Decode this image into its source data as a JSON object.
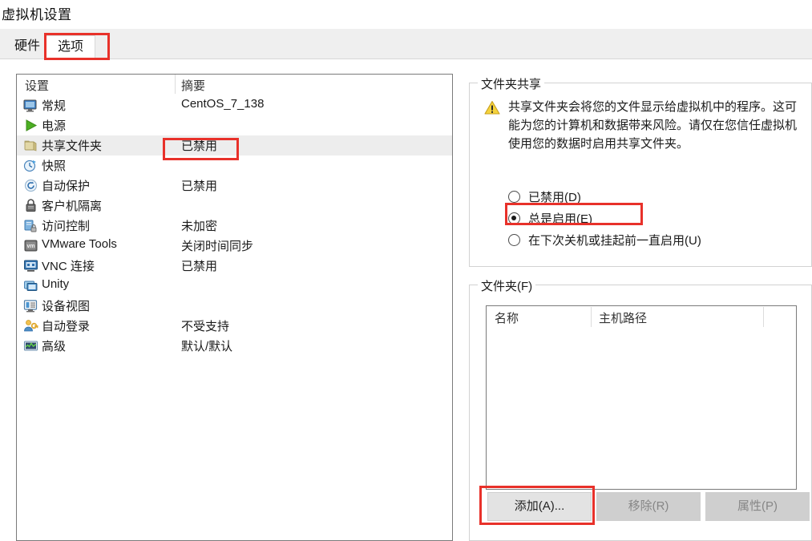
{
  "dialog": {
    "title": "虚拟机设置"
  },
  "tabs": [
    {
      "label": "硬件",
      "active": false
    },
    {
      "label": "选项",
      "active": true
    }
  ],
  "settings_list": {
    "columns": [
      "设置",
      "摘要"
    ],
    "rows": [
      {
        "label": "常规",
        "summary": "CentOS_7_138",
        "icon": "monitor-icon",
        "selected": false
      },
      {
        "label": "电源",
        "summary": "",
        "icon": "power-play-icon",
        "selected": false
      },
      {
        "label": "共享文件夹",
        "summary": "已禁用",
        "icon": "folder-icon",
        "selected": true
      },
      {
        "label": "快照",
        "summary": "",
        "icon": "snapshot-icon",
        "selected": false
      },
      {
        "label": "自动保护",
        "summary": "已禁用",
        "icon": "autoprotect-icon",
        "selected": false
      },
      {
        "label": "客户机隔离",
        "summary": "",
        "icon": "lock-icon",
        "selected": false
      },
      {
        "label": "访问控制",
        "summary": "未加密",
        "icon": "access-control-icon",
        "selected": false
      },
      {
        "label": "VMware Tools",
        "summary": "关闭时间同步",
        "icon": "vmware-tools-icon",
        "selected": false
      },
      {
        "label": "VNC 连接",
        "summary": "已禁用",
        "icon": "vnc-icon",
        "selected": false
      },
      {
        "label": "Unity",
        "summary": "",
        "icon": "unity-icon",
        "selected": false
      },
      {
        "label": "设备视图",
        "summary": "",
        "icon": "device-view-icon",
        "selected": false
      },
      {
        "label": "自动登录",
        "summary": "不受支持",
        "icon": "auto-login-icon",
        "selected": false
      },
      {
        "label": "高级",
        "summary": "默认/默认",
        "icon": "advanced-icon",
        "selected": false
      }
    ]
  },
  "folder_sharing": {
    "legend": "文件夹共享",
    "warning": "共享文件夹会将您的文件显示给虚拟机中的程序。这可能为您的计算机和数据带来风险。请仅在您信任虚拟机使用您的数据时启用共享文件夹。",
    "options": [
      {
        "label": "已禁用(D)",
        "checked": false
      },
      {
        "label": "总是启用(E)",
        "checked": true
      },
      {
        "label": "在下次关机或挂起前一直启用(U)",
        "checked": false
      }
    ]
  },
  "folders": {
    "legend": "文件夹(F)",
    "columns": [
      "名称",
      "主机路径"
    ],
    "rows": [],
    "buttons": [
      {
        "label": "添加(A)...",
        "enabled": true
      },
      {
        "label": "移除(R)",
        "enabled": false
      },
      {
        "label": "属性(P)",
        "enabled": false
      }
    ]
  },
  "highlights": {
    "color": "#e8312a",
    "targets": [
      "tab-options",
      "shared-folders-summary",
      "always-enabled-radio",
      "add-button"
    ]
  }
}
